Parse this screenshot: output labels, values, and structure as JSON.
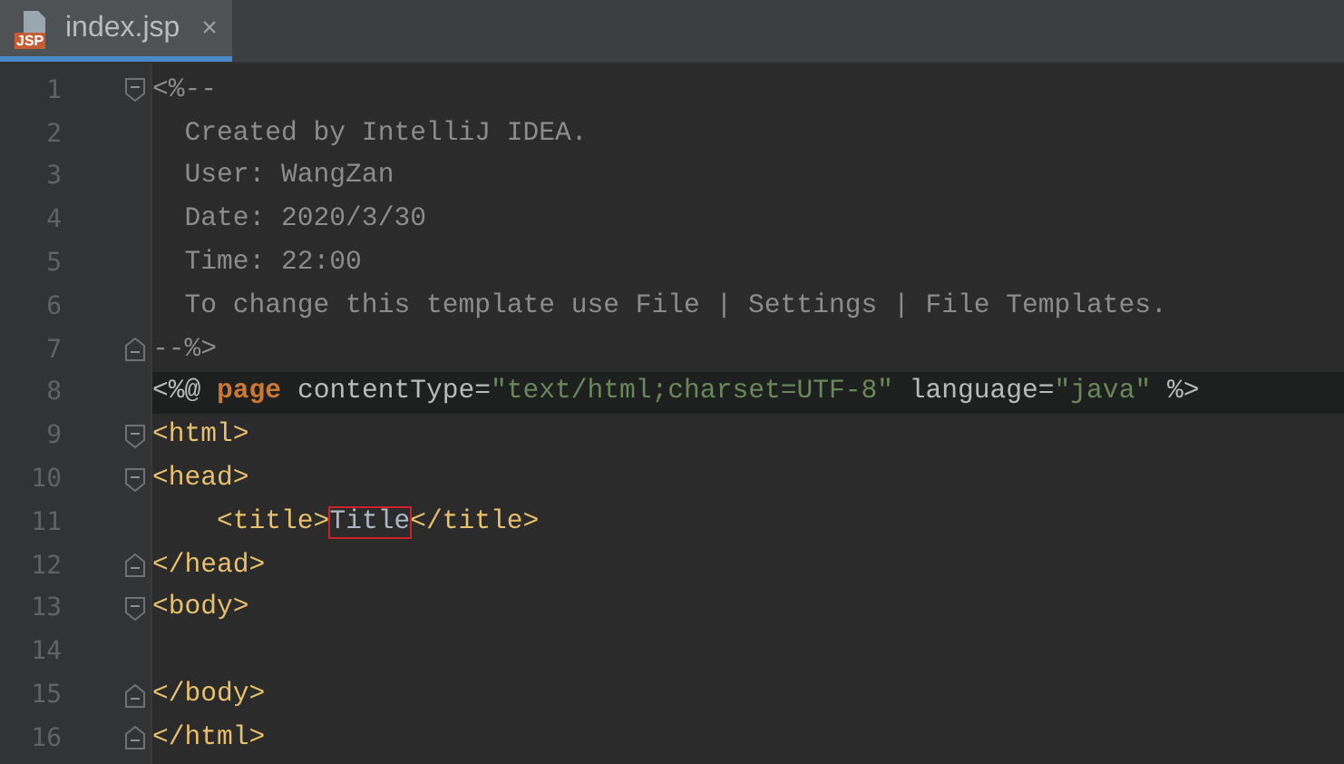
{
  "tabs": [
    {
      "label": "index.jsp",
      "icon_text": "JSP",
      "close_glyph": "×",
      "selected": true
    }
  ],
  "lines": [
    {
      "number": "1",
      "fold_open": true,
      "fold_close": false,
      "highlighted": false,
      "tokens": [
        {
          "kind": "comment",
          "text": "<%--"
        }
      ]
    },
    {
      "number": "2",
      "fold_open": false,
      "fold_close": false,
      "highlighted": false,
      "tokens": [
        {
          "kind": "comment",
          "text": "  Created by IntelliJ IDEA."
        }
      ]
    },
    {
      "number": "3",
      "fold_open": false,
      "fold_close": false,
      "highlighted": false,
      "tokens": [
        {
          "kind": "comment",
          "text": "  User: WangZan"
        }
      ]
    },
    {
      "number": "4",
      "fold_open": false,
      "fold_close": false,
      "highlighted": false,
      "tokens": [
        {
          "kind": "comment",
          "text": "  Date: 2020/3/30"
        }
      ]
    },
    {
      "number": "5",
      "fold_open": false,
      "fold_close": false,
      "highlighted": false,
      "tokens": [
        {
          "kind": "comment",
          "text": "  Time: 22:00"
        }
      ]
    },
    {
      "number": "6",
      "fold_open": false,
      "fold_close": false,
      "highlighted": false,
      "tokens": [
        {
          "kind": "comment",
          "text": "  To change this template use File | Settings | File Templates."
        }
      ]
    },
    {
      "number": "7",
      "fold_open": false,
      "fold_close": true,
      "highlighted": false,
      "tokens": [
        {
          "kind": "comment",
          "text": "--%>"
        }
      ]
    },
    {
      "number": "8",
      "fold_open": false,
      "fold_close": false,
      "highlighted": true,
      "tokens": [
        {
          "kind": "directive",
          "text": "<%@ "
        },
        {
          "kind": "keyword",
          "text": "page"
        },
        {
          "kind": "attribute",
          "text": " contentType="
        },
        {
          "kind": "string",
          "text": "\"text/html;charset=UTF-8\""
        },
        {
          "kind": "attribute",
          "text": " language="
        },
        {
          "kind": "string",
          "text": "\"java\""
        },
        {
          "kind": "directive",
          "text": " %>"
        }
      ]
    },
    {
      "number": "9",
      "fold_open": true,
      "fold_close": false,
      "highlighted": false,
      "tokens": [
        {
          "kind": "tag",
          "text": "<html>"
        }
      ]
    },
    {
      "number": "10",
      "fold_open": true,
      "fold_close": false,
      "highlighted": false,
      "tokens": [
        {
          "kind": "tag",
          "text": "<head>"
        }
      ]
    },
    {
      "number": "11",
      "fold_open": false,
      "fold_close": false,
      "highlighted": false,
      "tokens": [
        {
          "kind": "tag",
          "text": "    <title>"
        },
        {
          "kind": "text",
          "text": "Title",
          "boxed": true
        },
        {
          "kind": "tag",
          "text": "</title>"
        }
      ]
    },
    {
      "number": "12",
      "fold_open": false,
      "fold_close": true,
      "highlighted": false,
      "tokens": [
        {
          "kind": "tag",
          "text": "</head>"
        }
      ]
    },
    {
      "number": "13",
      "fold_open": true,
      "fold_close": false,
      "highlighted": false,
      "tokens": [
        {
          "kind": "tag",
          "text": "<body>"
        }
      ]
    },
    {
      "number": "14",
      "fold_open": false,
      "fold_close": false,
      "highlighted": false
    },
    {
      "number": "15",
      "fold_open": false,
      "fold_close": true,
      "highlighted": false,
      "tokens": [
        {
          "kind": "tag",
          "text": "</body>"
        }
      ]
    },
    {
      "number": "16",
      "fold_open": false,
      "fold_close": true,
      "highlighted": false,
      "tokens": [
        {
          "kind": "tag",
          "text": "</html>"
        }
      ]
    }
  ]
}
